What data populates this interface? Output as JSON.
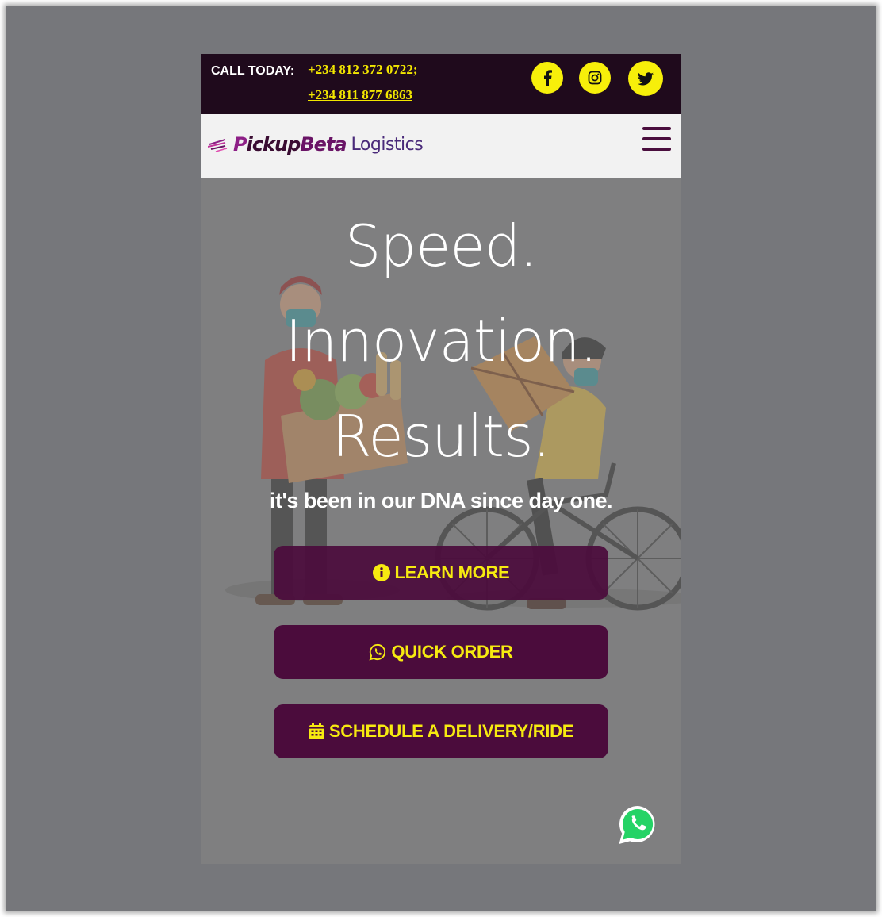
{
  "topbar": {
    "call_label": "CALL TODAY:",
    "phones": [
      "+234 812 372 0722;",
      "+234 811 877 6863"
    ],
    "social": [
      {
        "name": "facebook",
        "icon": "facebook-icon",
        "glyph": "f"
      },
      {
        "name": "instagram",
        "icon": "instagram-icon"
      },
      {
        "name": "twitter",
        "icon": "twitter-icon"
      }
    ],
    "bg": "#1f0a1c",
    "accent": "#f7ef0a"
  },
  "navbar": {
    "brand_part1": "P",
    "brand_part2": "ickup",
    "brand_part3": "Beta",
    "brand_sub": "Logistics",
    "menu_icon": "hamburger-menu-icon"
  },
  "hero": {
    "title_lines": [
      "Speed.",
      "Innovation.",
      "Results."
    ],
    "subtitle": "it's been in our DNA since day one.",
    "buttons": {
      "learn_more": {
        "label": "LEARN MORE",
        "icon": "info-circle-icon"
      },
      "quick_order": {
        "label": "QUICK ORDER",
        "icon": "whatsapp-icon"
      },
      "schedule": {
        "label": "SCHEDULE A DELIVERY/RIDE",
        "icon": "calendar-icon"
      }
    },
    "button_bg": "#4b0c3c",
    "button_text": "#f6ea10"
  },
  "floating": {
    "whatsapp_icon": "whatsapp-float-icon"
  }
}
